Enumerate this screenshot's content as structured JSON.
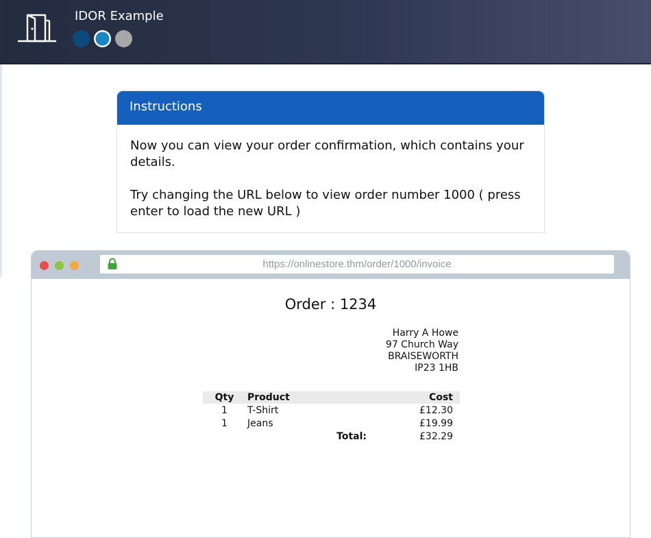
{
  "app": {
    "title": "IDOR Example"
  },
  "progress_dots": [
    {
      "state": "done",
      "color": "#0b4a7a"
    },
    {
      "state": "current",
      "color": "#1a86c8"
    },
    {
      "state": "todo",
      "color": "#a7a7a7"
    }
  ],
  "instructions": {
    "heading": "Instructions",
    "paragraph_1": "Now you can view your order confirmation, which contains your details.",
    "paragraph_2": "Try changing the URL below to view order number 1000 ( press enter to load the new URL )"
  },
  "browser": {
    "url": "https://onlinestore.thm/order/1000/invoice",
    "lock_icon": "padlock-icon",
    "window_buttons": [
      "#ee4d4d",
      "#8cc63f",
      "#f5a742"
    ]
  },
  "order": {
    "title": "Order : 1234",
    "address": {
      "name": "Harry A Howe",
      "street": "97 Church Way",
      "town": "BRAISEWORTH",
      "postcode": "IP23 1HB"
    },
    "columns": {
      "qty": "Qty",
      "product": "Product",
      "cost": "Cost"
    },
    "lines": [
      {
        "qty": "1",
        "product": "T-Shirt",
        "cost": "£12.30"
      },
      {
        "qty": "1",
        "product": "Jeans",
        "cost": "£19.99"
      }
    ],
    "total_label": "Total:",
    "total_value": "£32.29"
  },
  "colors": {
    "header_gradient_start": "#232b3f",
    "header_gradient_end": "#474e6c",
    "instructions_header": "#1560bd"
  }
}
